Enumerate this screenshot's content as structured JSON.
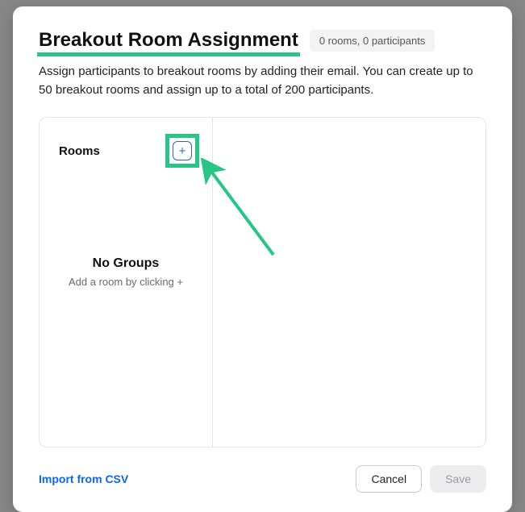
{
  "header": {
    "title": "Breakout Room Assignment",
    "badge": "0 rooms, 0 participants"
  },
  "description": "Assign participants to breakout rooms by adding their email. You can create up to 50 breakout rooms and assign up to a total of 200 participants.",
  "rooms": {
    "label": "Rooms",
    "add_glyph": "+",
    "empty_title": "No Groups",
    "empty_hint": "Add a room by clicking +"
  },
  "footer": {
    "import_label": "Import from CSV",
    "cancel_label": "Cancel",
    "save_label": "Save"
  }
}
